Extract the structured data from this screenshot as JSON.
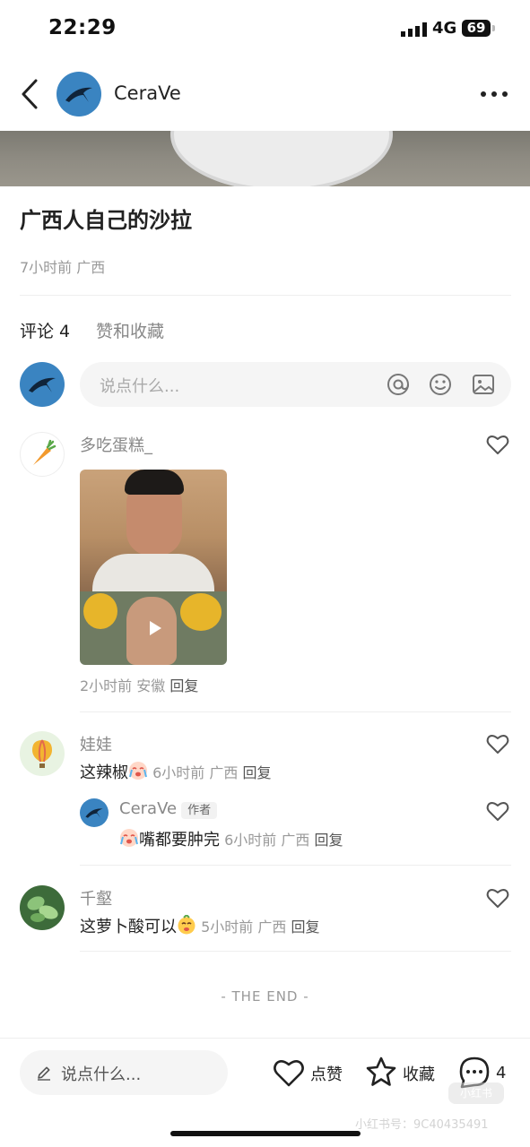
{
  "status_bar": {
    "time": "22:29",
    "network": "4G",
    "battery": "69"
  },
  "header": {
    "username": "CeraVe"
  },
  "post": {
    "title": "广西人自己的沙拉",
    "meta": "7小时前 广西"
  },
  "tabs": {
    "comments": "评论 4",
    "likes": "赞和收藏"
  },
  "comment_input": {
    "placeholder": "说点什么..."
  },
  "comments": [
    {
      "name": "多吃蛋糕_",
      "meta": "2小时前 安徽",
      "reply": "回复"
    },
    {
      "name": "娃娃",
      "text": "这辣椒",
      "meta": "6小时前 广西",
      "reply": "回复",
      "sub": {
        "name": "CeraVe",
        "tag": "作者",
        "text": "嘴都要肿完",
        "meta": "6小时前 广西",
        "reply": "回复"
      }
    },
    {
      "name": "千壑",
      "text": "这萝卜酸可以",
      "meta": "5小时前 广西",
      "reply": "回复"
    }
  ],
  "end_text": "- THE END -",
  "bottom_bar": {
    "placeholder": "说点什么...",
    "like": "点赞",
    "collect": "收藏",
    "comment_count": "4"
  },
  "watermark": {
    "app": "小红书",
    "id": "小红书号：9C40435491"
  }
}
